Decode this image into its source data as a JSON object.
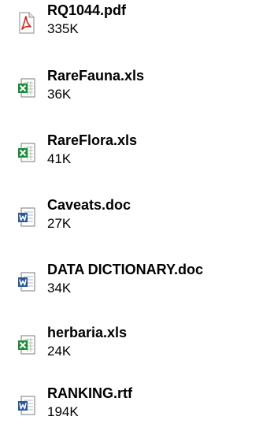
{
  "files": [
    {
      "name": "RQ1044.pdf",
      "size": "335K",
      "icon": "pdf-file-icon"
    },
    {
      "name": "RareFauna.xls",
      "size": "36K",
      "icon": "excel-file-icon"
    },
    {
      "name": "RareFlora.xls",
      "size": "41K",
      "icon": "excel-file-icon"
    },
    {
      "name": "Caveats.doc",
      "size": "27K",
      "icon": "word-file-icon"
    },
    {
      "name": "DATA DICTIONARY.doc",
      "size": "34K",
      "icon": "word-file-icon"
    },
    {
      "name": "herbaria.xls",
      "size": "24K",
      "icon": "excel-file-icon"
    },
    {
      "name": "RANKING.rtf",
      "size": "194K",
      "icon": "word-file-icon"
    }
  ],
  "colors": {
    "pdf_red": "#d8231e",
    "excel_green": "#1f8a3b",
    "word_blue": "#2b5797"
  }
}
